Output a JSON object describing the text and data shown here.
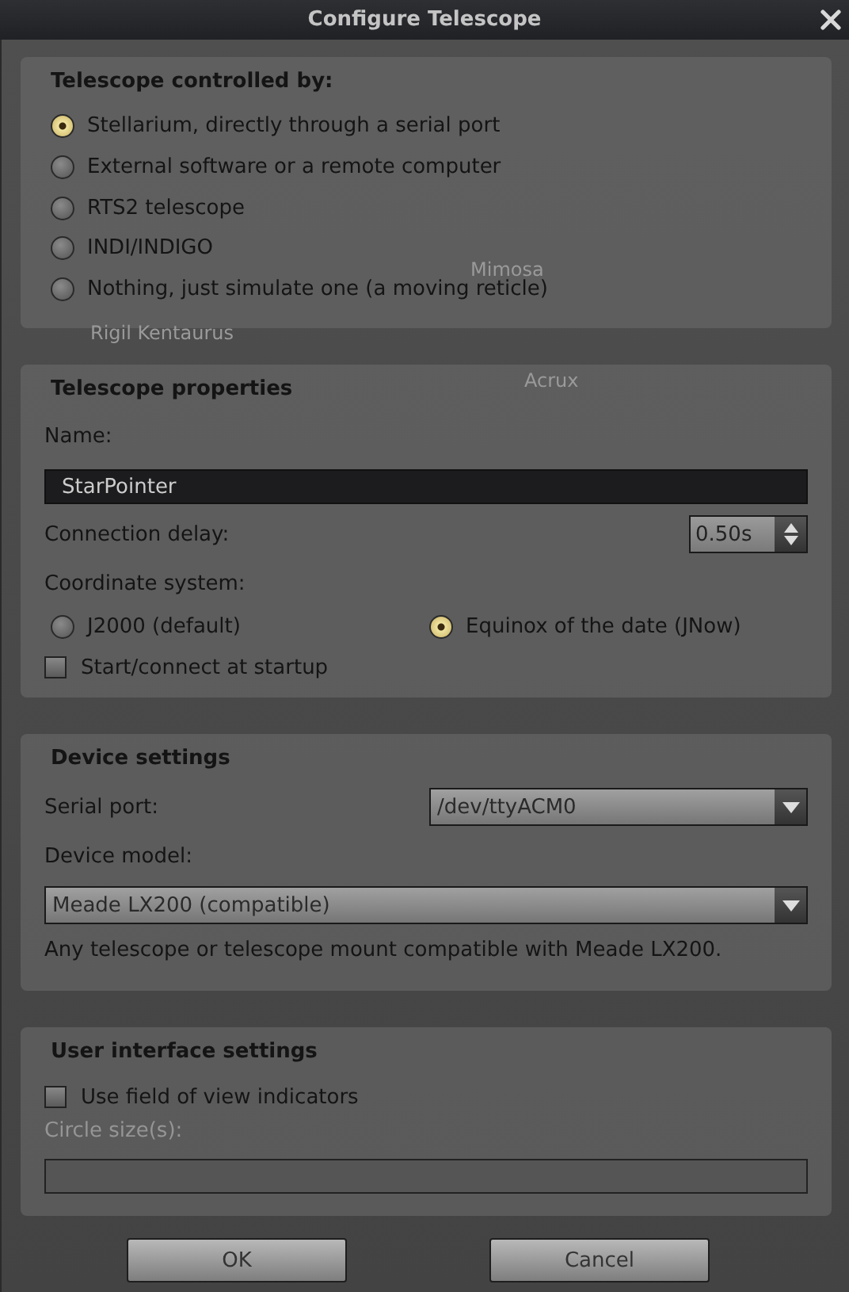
{
  "window": {
    "title": "Configure Telescope"
  },
  "sky_labels": [
    "Mimosa",
    "Rigil Kentaurus",
    "Acrux"
  ],
  "controlled_by": {
    "heading": "Telescope controlled by:",
    "options": [
      {
        "label": "Stellarium, directly through a serial port",
        "selected": true
      },
      {
        "label": "External software or a remote computer",
        "selected": false
      },
      {
        "label": "RTS2 telescope",
        "selected": false
      },
      {
        "label": "INDI/INDIGO",
        "selected": false
      },
      {
        "label": "Nothing, just simulate one (a moving reticle)",
        "selected": false
      }
    ]
  },
  "properties": {
    "heading": "Telescope properties",
    "name_label": "Name:",
    "name_value": "StarPointer",
    "delay_label": "Connection delay:",
    "delay_value": "0.50s",
    "coord_label": "Coordinate system:",
    "coord_options": [
      {
        "label": "J2000 (default)",
        "selected": false
      },
      {
        "label": "Equinox of the date (JNow)",
        "selected": true
      }
    ],
    "startup": {
      "label": "Start/connect at startup",
      "checked": false
    }
  },
  "device": {
    "heading": "Device settings",
    "serial_label": "Serial port:",
    "serial_value": "/dev/ttyACM0",
    "model_label": "Device model:",
    "model_value": "Meade LX200 (compatible)",
    "model_note": "Any telescope or telescope mount compatible with Meade LX200."
  },
  "ui": {
    "heading": "User interface settings",
    "fov": {
      "label": "Use field of view indicators",
      "checked": false
    },
    "circle_label": "Circle size(s):",
    "circle_disabled": true
  },
  "buttons": [
    "OK",
    "Cancel"
  ]
}
